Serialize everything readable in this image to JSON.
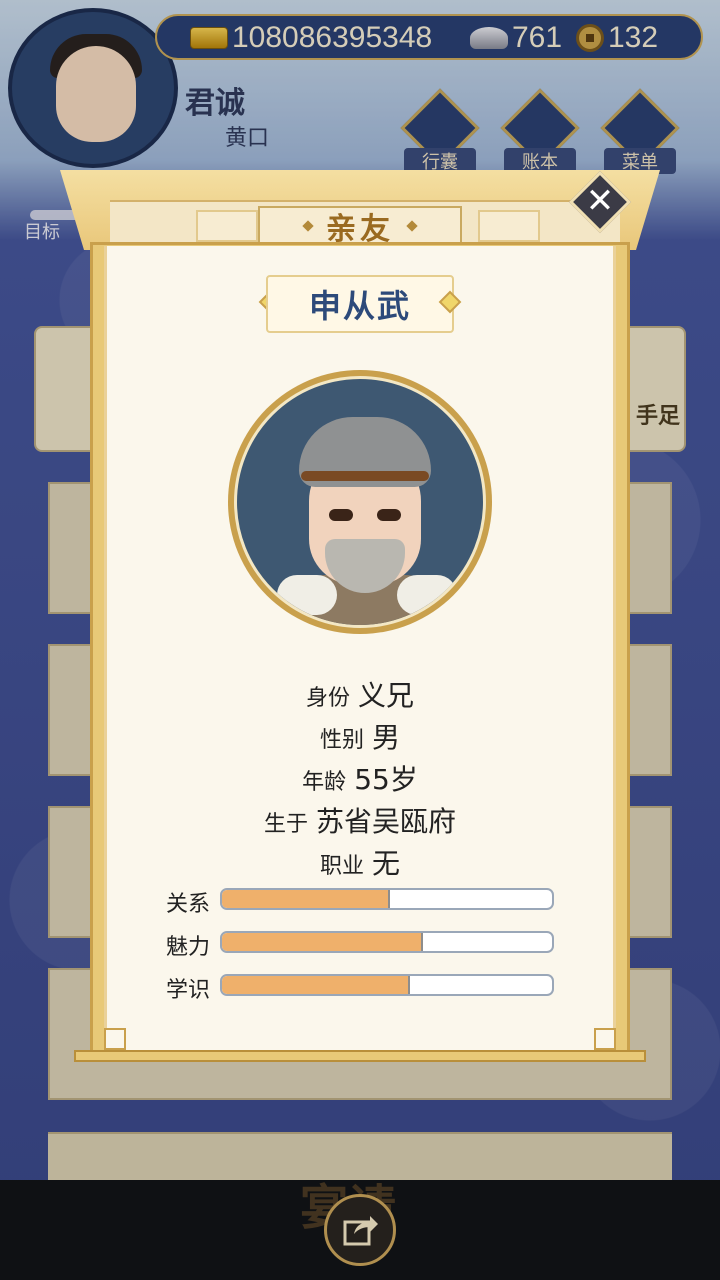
{
  "resources": {
    "gold": "108086395348",
    "silver": "761",
    "coin": "132"
  },
  "player": {
    "name": "君诚",
    "title": "黄口",
    "target_label": "目标"
  },
  "menu": [
    {
      "label": "行囊",
      "icon": "bag-icon"
    },
    {
      "label": "账本",
      "icon": "ledger-icon"
    },
    {
      "label": "菜单",
      "icon": "more-icon"
    }
  ],
  "background": {
    "side_text": "手足",
    "banquet": "宴请"
  },
  "modal": {
    "title": "亲友",
    "close": "✕",
    "character": {
      "name": "申从武",
      "identity_label": "身份",
      "identity": "义兄",
      "gender_label": "性别",
      "gender": "男",
      "age_label": "年龄",
      "age": "55岁",
      "birthplace_label": "生于",
      "birthplace": "苏省吴瓯府",
      "occupation_label": "职业",
      "occupation": "无"
    },
    "stats": [
      {
        "label": "关系",
        "fraction": 0.51
      },
      {
        "label": "魅力",
        "fraction": 0.61
      },
      {
        "label": "学识",
        "fraction": 0.57
      }
    ]
  },
  "colors": {
    "bar_fill": "#efb06b",
    "title_color": "#9a6a20",
    "name_color": "#2d4a7a"
  }
}
